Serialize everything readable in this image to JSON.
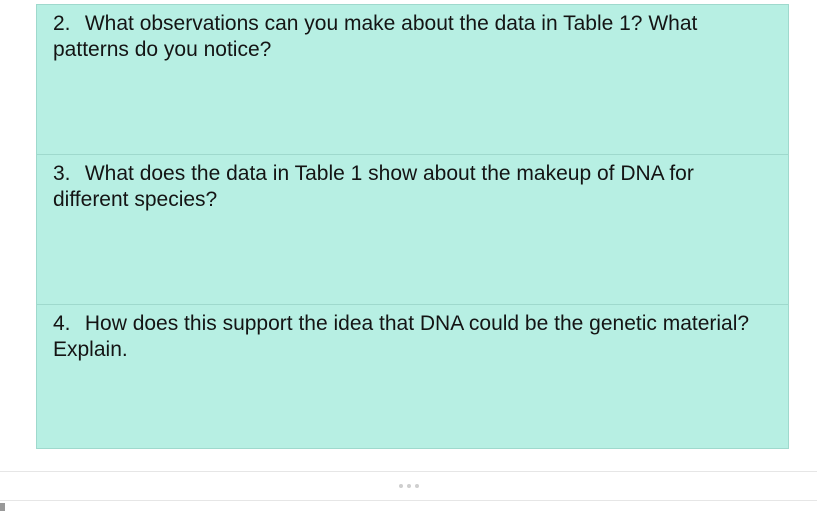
{
  "questions": [
    {
      "number": "2.",
      "text": "What observations can you make about the data in Table 1? What patterns do you notice?"
    },
    {
      "number": "3.",
      "text": "What does the data in Table 1 show about the makeup of DNA for different species?"
    },
    {
      "number": "4.",
      "text": "How does this support the idea that DNA could be the genetic material? Explain."
    }
  ]
}
